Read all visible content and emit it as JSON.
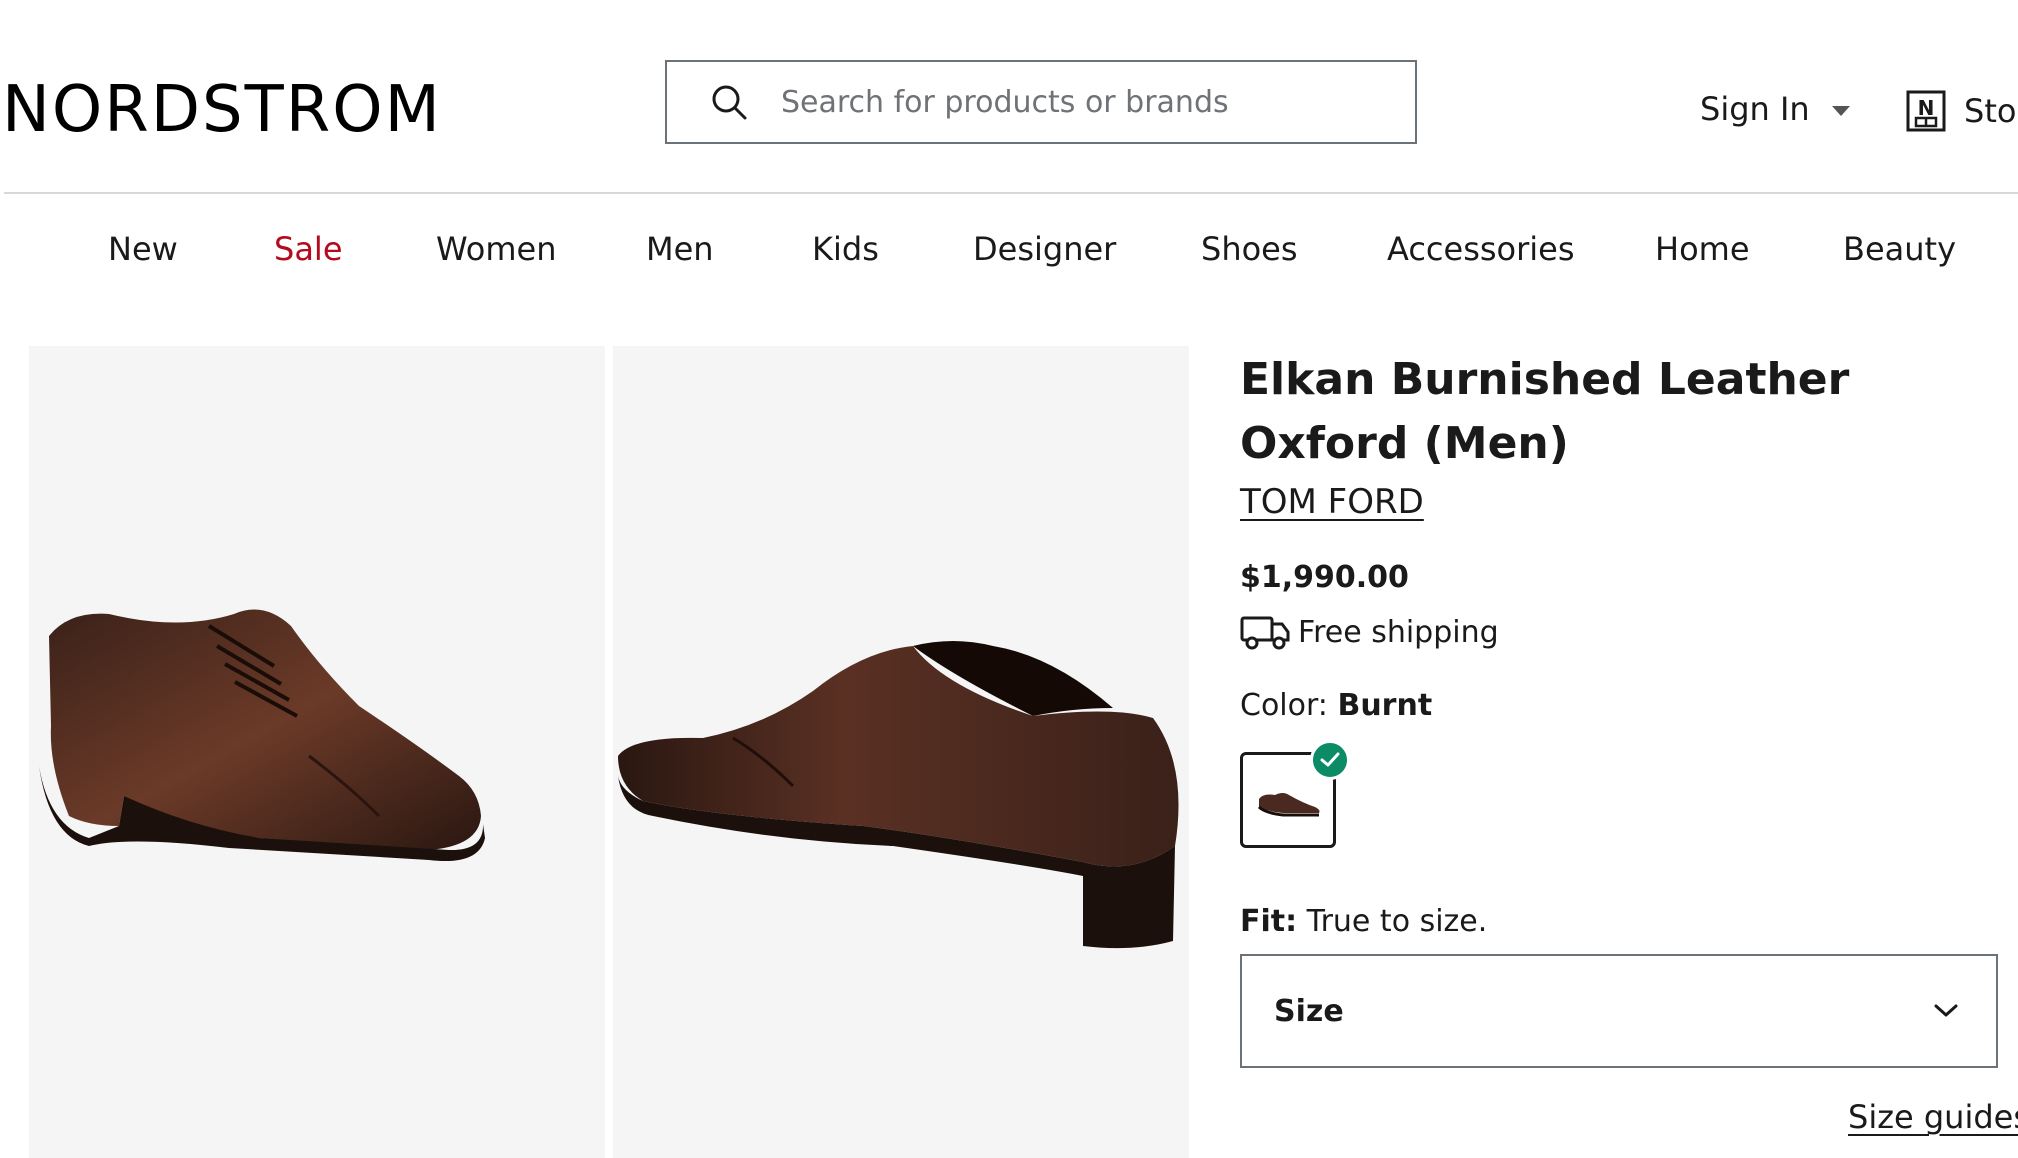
{
  "header": {
    "logo": "NORDSTROM",
    "search_placeholder": "Search for products or brands",
    "sign_in": "Sign In",
    "stores": "Stores"
  },
  "nav": {
    "items": [
      "New",
      "Sale",
      "Women",
      "Men",
      "Kids",
      "Designer",
      "Shoes",
      "Accessories",
      "Home",
      "Beauty"
    ]
  },
  "product": {
    "title": "Elkan Burnished Leather Oxford (Men)",
    "brand": "TOM FORD",
    "price": "$1,990.00",
    "shipping": "Free shipping",
    "color_label": "Color:",
    "color_value": "Burnt",
    "fit_label": "Fit:",
    "fit_value": "True to size.",
    "size_label": "Size",
    "size_guides": "Size guides"
  },
  "colors": {
    "sale": "#b50a1e",
    "check": "#0b8c66",
    "leather": "#4a2a20"
  }
}
